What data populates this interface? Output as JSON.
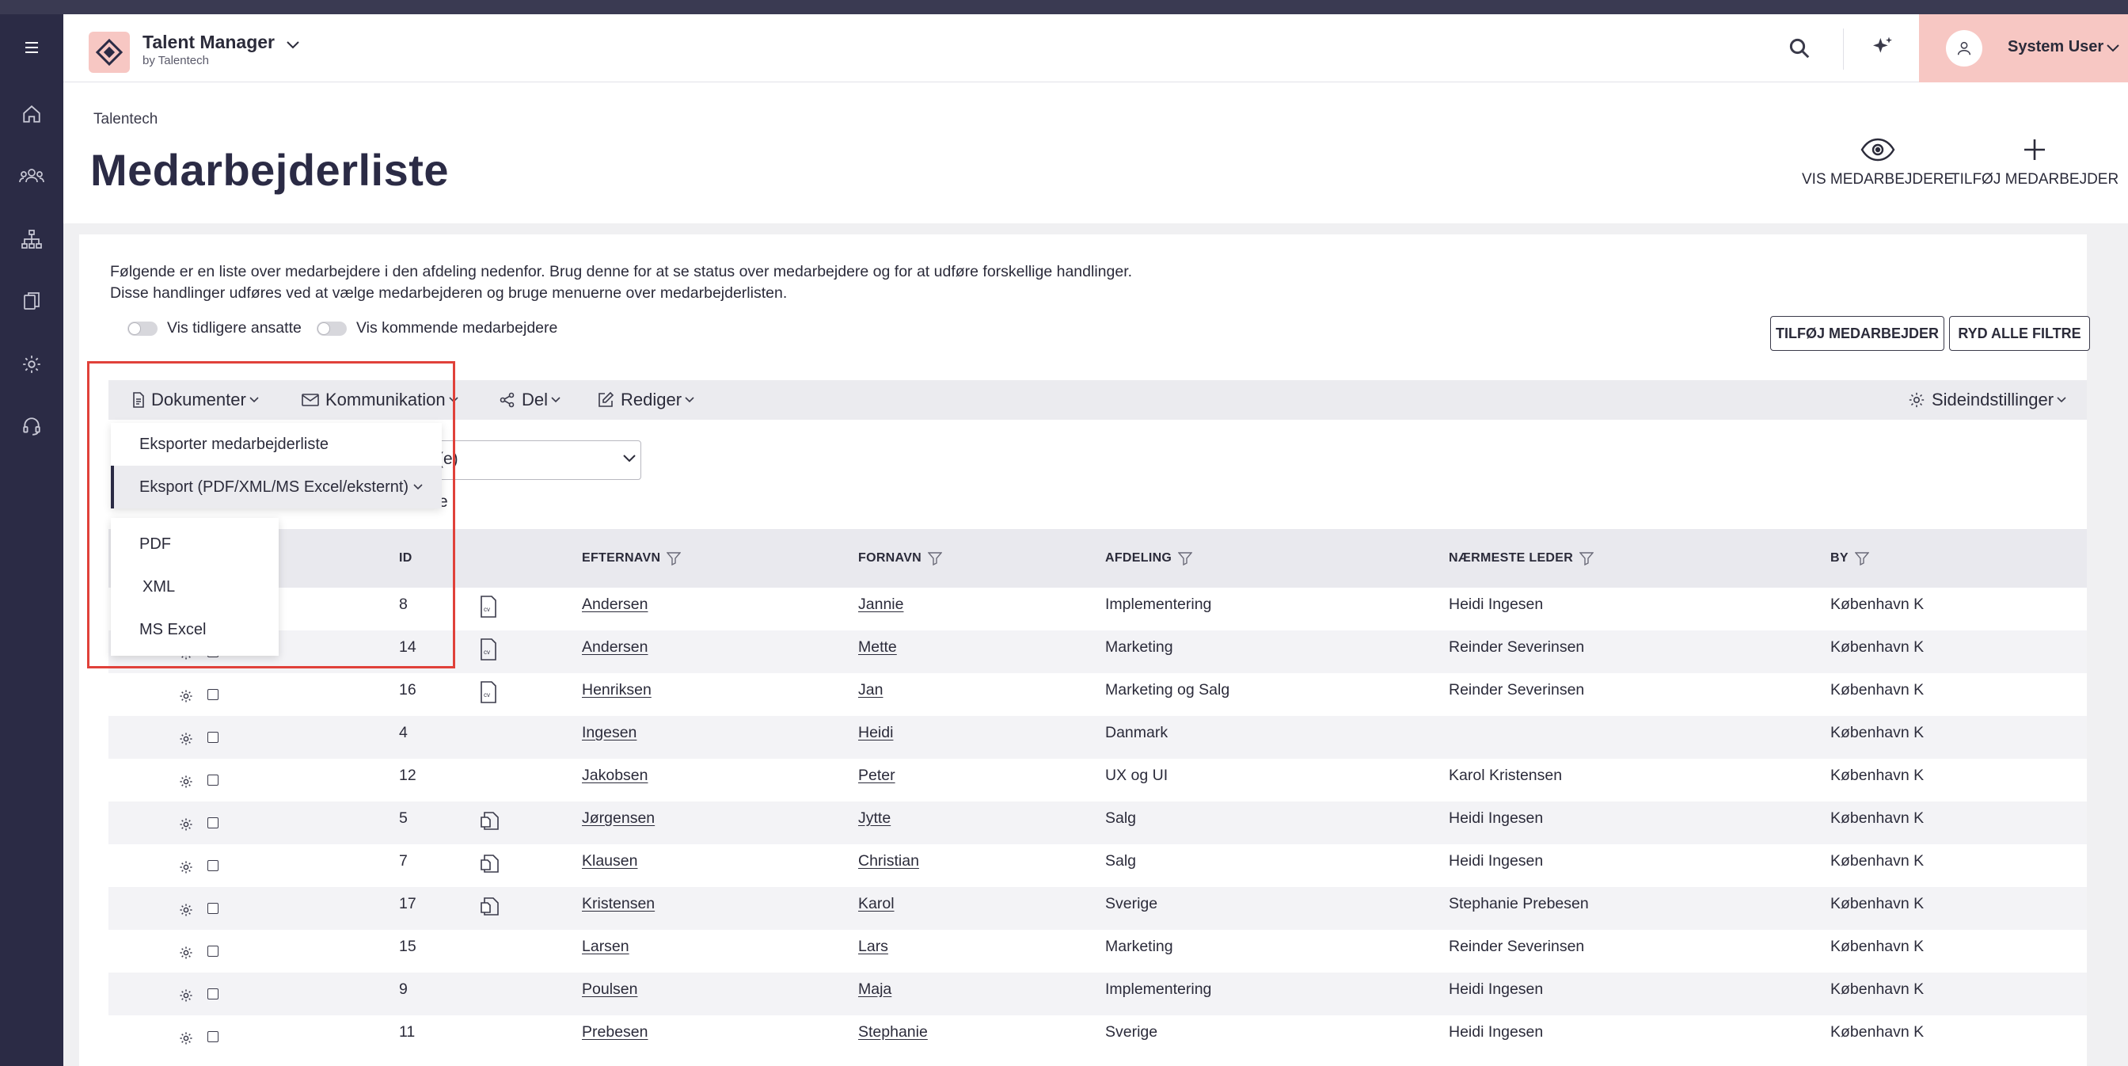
{
  "header": {
    "app_title": "Talent Manager",
    "app_subtitle": "by Talentech",
    "user_name": "System User"
  },
  "page": {
    "breadcrumb": "Talentech",
    "title": "Medarbejderliste",
    "actions": [
      {
        "label": "VIS MEDARBEJDERE",
        "icon": "eye-icon"
      },
      {
        "label": "TILFØJ MEDARBEJDER",
        "icon": "plus-icon"
      }
    ]
  },
  "card": {
    "desc_line1": "Følgende er en liste over medarbejdere i den afdeling nedenfor. Brug denne for at se status over medarbejdere og for at udføre forskellige handlinger.",
    "desc_line2": "Disse handlinger udføres ved at vælge medarbejderen og bruge menuerne over medarbejderlisten.",
    "toggle_former": "Vis tidligere ansatte",
    "toggle_upcoming": "Vis kommende medarbejdere",
    "btn_add": "TILFØJ MEDARBEJDER",
    "btn_clear": "RYD ALLE FILTRE"
  },
  "toolbar": {
    "documents": "Dokumenter",
    "communication": "Kommunikation",
    "share": "Del",
    "edit": "Rediger",
    "page_settings": "Sideindstillinger"
  },
  "filter": {
    "select_text": "(e)",
    "partial_text": "e"
  },
  "dropdown": {
    "items": [
      "Eksporter medarbejderliste",
      "Eksport (PDF/XML/MS Excel/eksternt)"
    ],
    "submenu": [
      "PDF",
      "XML",
      "MS Excel"
    ]
  },
  "table": {
    "headers": {
      "id": "ID",
      "lastname": "EFTERNAVN",
      "firstname": "FORNAVN",
      "department": "AFDELING",
      "manager": "NÆRMESTE LEDER",
      "city": "BY"
    },
    "rows": [
      {
        "id": "8",
        "doc": "cv",
        "lastname": "Andersen",
        "firstname": "Jannie",
        "department": "Implementering",
        "manager": "Heidi Ingesen",
        "city": "København K"
      },
      {
        "id": "14",
        "doc": "cv",
        "lastname": "Andersen",
        "firstname": "Mette",
        "department": "Marketing",
        "manager": "Reinder Severinsen",
        "city": "København K"
      },
      {
        "id": "16",
        "doc": "cv",
        "lastname": "Henriksen",
        "firstname": "Jan",
        "department": "Marketing og Salg",
        "manager": "Reinder Severinsen",
        "city": "København K"
      },
      {
        "id": "4",
        "doc": "",
        "lastname": "Ingesen",
        "firstname": "Heidi",
        "department": "Danmark",
        "manager": "",
        "city": "København K"
      },
      {
        "id": "12",
        "doc": "",
        "lastname": "Jakobsen",
        "firstname": "Peter",
        "department": "UX og UI",
        "manager": "Karol Kristensen",
        "city": "København K"
      },
      {
        "id": "5",
        "doc": "file",
        "lastname": "Jørgensen",
        "firstname": "Jytte",
        "department": "Salg",
        "manager": "Heidi Ingesen",
        "city": "København K"
      },
      {
        "id": "7",
        "doc": "file",
        "lastname": "Klausen",
        "firstname": "Christian",
        "department": "Salg",
        "manager": "Heidi Ingesen",
        "city": "København K"
      },
      {
        "id": "17",
        "doc": "file",
        "lastname": "Kristensen",
        "firstname": "Karol",
        "department": "Sverige",
        "manager": "Stephanie Prebesen",
        "city": "København K"
      },
      {
        "id": "15",
        "doc": "",
        "lastname": "Larsen",
        "firstname": "Lars",
        "department": "Marketing",
        "manager": "Reinder Severinsen",
        "city": "København K"
      },
      {
        "id": "9",
        "doc": "",
        "lastname": "Poulsen",
        "firstname": "Maja",
        "department": "Implementering",
        "manager": "Heidi Ingesen",
        "city": "København K"
      },
      {
        "id": "11",
        "doc": "",
        "lastname": "Prebesen",
        "firstname": "Stephanie",
        "department": "Sverige",
        "manager": "Heidi Ingesen",
        "city": "København K"
      }
    ]
  },
  "colors": {
    "sidebar": "#2b2b45",
    "accent_pink": "#f7c7c3",
    "highlight_red": "#e0413a"
  }
}
